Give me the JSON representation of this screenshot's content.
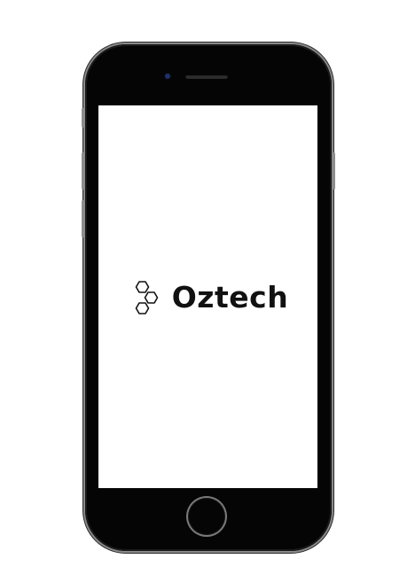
{
  "device": {
    "type": "smartphone",
    "frame_color": "#050505",
    "bezel_highlight": "#8a8a8a",
    "camera_color": "#1e2f6e"
  },
  "screen": {
    "background": "#ffffff",
    "logo": {
      "mark_icon": "hexagon-cluster-icon",
      "text": "Oztech",
      "color": "#111111"
    }
  }
}
